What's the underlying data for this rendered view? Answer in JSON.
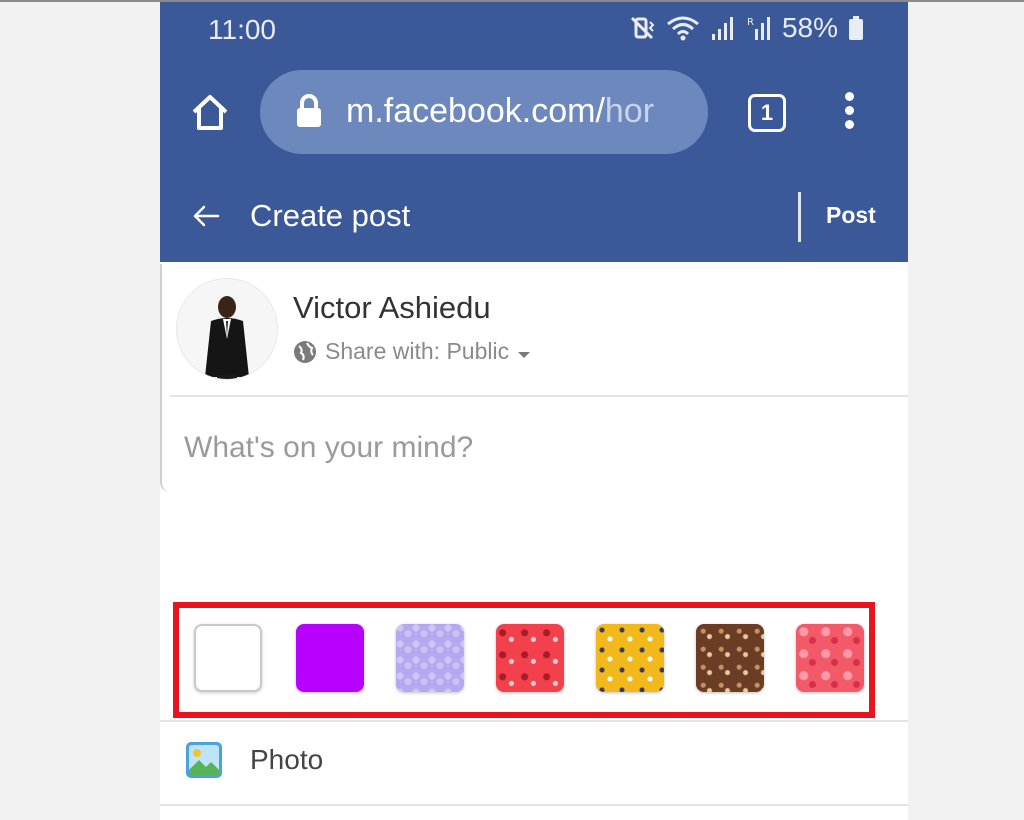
{
  "status_bar": {
    "time": "11:00",
    "battery": "58%",
    "icons": [
      "mute-vibrate-icon",
      "wifi-icon",
      "signal-icon",
      "roaming-signal-icon",
      "battery-icon"
    ]
  },
  "browser": {
    "url_main": "m.facebook.com/",
    "url_dim": "hor",
    "tab_count": "1",
    "icons": [
      "home-icon",
      "lock-icon",
      "tabs-icon",
      "menu-icon"
    ]
  },
  "header": {
    "title": "Create post",
    "post_label": "Post",
    "background_color": "#3b5998"
  },
  "composer": {
    "user_name": "Victor Ashiedu",
    "share_label": "Share with: Public",
    "placeholder": "What's on your mind?"
  },
  "backgrounds": {
    "highlight_color": "#e8141e",
    "swatches": [
      {
        "name": "white",
        "color": "#ffffff"
      },
      {
        "name": "purple",
        "color": "#b800ff"
      },
      {
        "name": "lavender-pattern",
        "color": "#b5a8ee"
      },
      {
        "name": "red-pattern",
        "color": "#f2404c"
      },
      {
        "name": "yellow-pattern",
        "color": "#f2b91c"
      },
      {
        "name": "brown-pattern",
        "color": "#6b3d24"
      },
      {
        "name": "pink-hearts-pattern",
        "color": "#f25a6a"
      }
    ]
  },
  "actions": {
    "photo_label": "Photo"
  }
}
